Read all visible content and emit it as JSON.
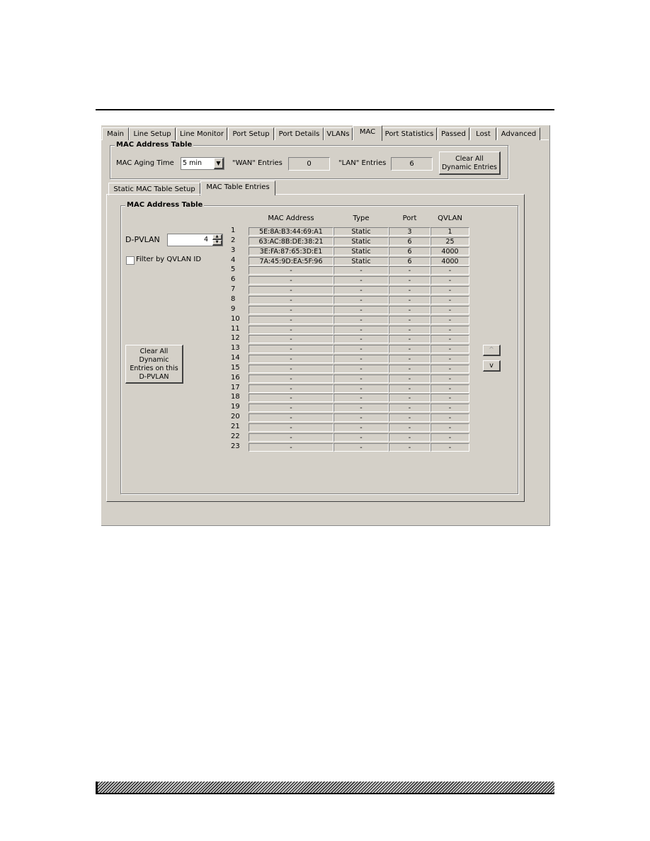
{
  "tabs": [
    "Main",
    "Line Setup",
    "Line Monitor",
    "Port Setup",
    "Port Details",
    "VLANs",
    "MAC",
    "Port Statistics",
    "Passed",
    "Lost",
    "Advanced"
  ],
  "selected_tab": "MAC",
  "top_group": {
    "title": "MAC Address Table",
    "aging_label": "MAC Aging Time",
    "aging_value": "5 min",
    "wan_label": "\"WAN\" Entries",
    "wan_value": "0",
    "lan_label": "\"LAN\" Entries",
    "lan_value": "6",
    "clear_button": [
      "Clear All",
      "Dynamic Entries"
    ]
  },
  "sub_tabs": [
    "Static MAC Table Setup",
    "MAC Table Entries"
  ],
  "selected_sub_tab": "MAC Table Entries",
  "inner_group": {
    "title": "MAC Address Table",
    "dpvlan_label": "D-PVLAN",
    "dpvlan_value": "4",
    "filter_label": "Filter by QVLAN ID",
    "filter_checked": false,
    "clear_button": [
      "Clear All",
      "Dynamic",
      "Entries on this",
      "D-PVLAN"
    ],
    "scroll_up": "^",
    "scroll_down": "v"
  },
  "table": {
    "headers": [
      "MAC Address",
      "Type",
      "Port",
      "QVLAN"
    ],
    "rows": [
      [
        "5E:8A:B3:44:69:A1",
        "Static",
        "3",
        "1"
      ],
      [
        "63:AC:8B:DE:38:21",
        "Static",
        "6",
        "25"
      ],
      [
        "3E:FA:87:65:3D:E1",
        "Static",
        "6",
        "4000"
      ],
      [
        "7A:45:9D:EA:5F:96",
        "Static",
        "6",
        "4000"
      ],
      [
        "-",
        "-",
        "-",
        "-"
      ],
      [
        "-",
        "-",
        "-",
        "-"
      ],
      [
        "-",
        "-",
        "-",
        "-"
      ],
      [
        "-",
        "-",
        "-",
        "-"
      ],
      [
        "-",
        "-",
        "-",
        "-"
      ],
      [
        "-",
        "-",
        "-",
        "-"
      ],
      [
        "-",
        "-",
        "-",
        "-"
      ],
      [
        "-",
        "-",
        "-",
        "-"
      ],
      [
        "-",
        "-",
        "-",
        "-"
      ],
      [
        "-",
        "-",
        "-",
        "-"
      ],
      [
        "-",
        "-",
        "-",
        "-"
      ],
      [
        "-",
        "-",
        "-",
        "-"
      ],
      [
        "-",
        "-",
        "-",
        "-"
      ],
      [
        "-",
        "-",
        "-",
        "-"
      ],
      [
        "-",
        "-",
        "-",
        "-"
      ],
      [
        "-",
        "-",
        "-",
        "-"
      ],
      [
        "-",
        "-",
        "-",
        "-"
      ],
      [
        "-",
        "-",
        "-",
        "-"
      ],
      [
        "-",
        "-",
        "-",
        "-"
      ]
    ]
  }
}
